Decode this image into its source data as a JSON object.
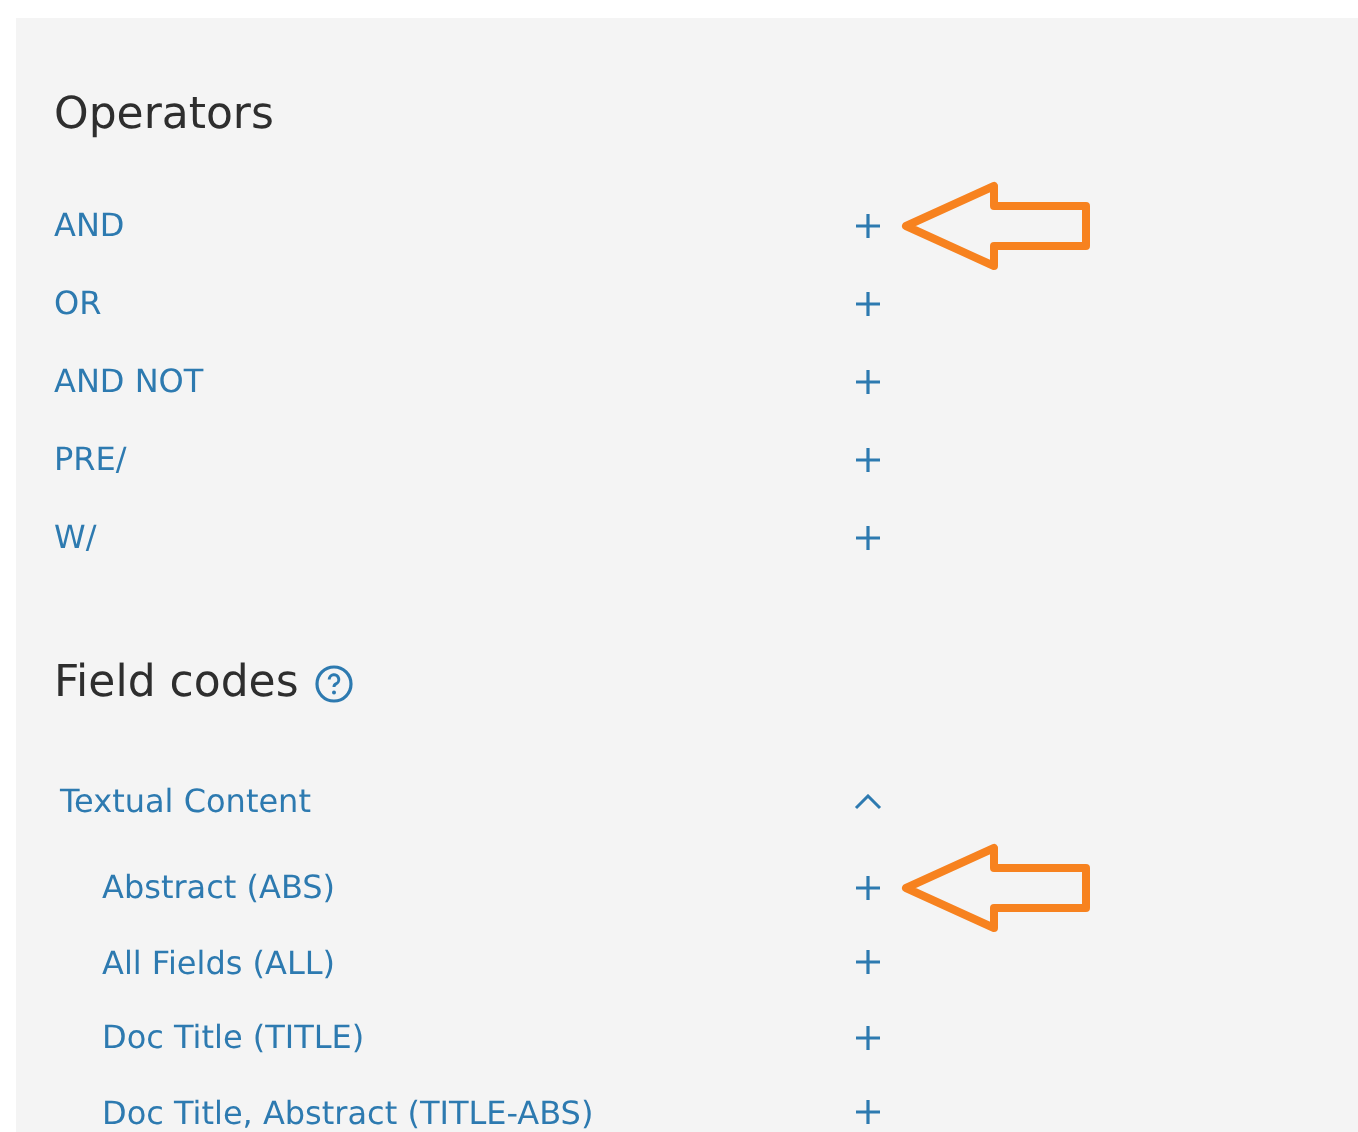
{
  "operators": {
    "title": "Operators",
    "items": [
      {
        "label": "AND",
        "highlighted": true
      },
      {
        "label": "OR",
        "highlighted": false
      },
      {
        "label": "AND NOT",
        "highlighted": false
      },
      {
        "label": "PRE/",
        "highlighted": false
      },
      {
        "label": "W/",
        "highlighted": false
      }
    ]
  },
  "field_codes": {
    "title": "Field codes",
    "categories": [
      {
        "label": "Textual Content",
        "expanded": true,
        "children": [
          {
            "label": "Abstract (ABS)",
            "highlighted": true
          },
          {
            "label": "All Fields (ALL)",
            "highlighted": false
          },
          {
            "label": "Doc Title (TITLE)",
            "highlighted": false
          },
          {
            "label": "Doc Title, Abstract (TITLE-ABS)",
            "highlighted": false
          }
        ]
      }
    ]
  }
}
